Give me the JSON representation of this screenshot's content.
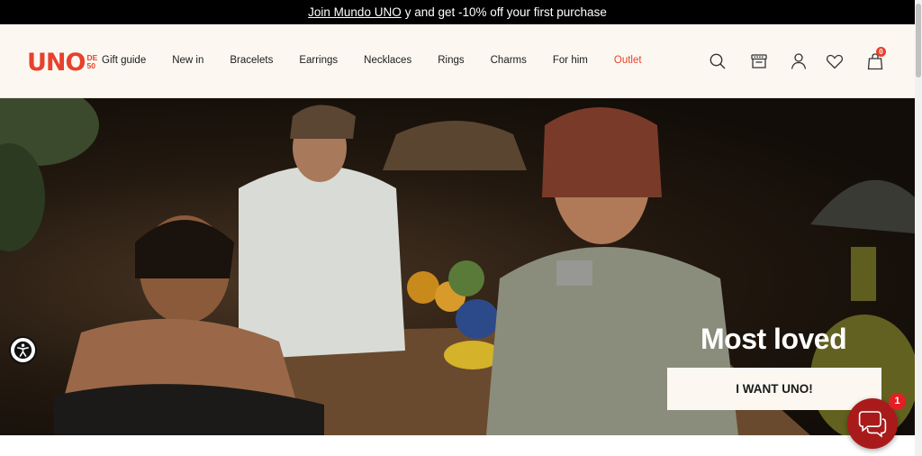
{
  "promo": {
    "link_text": "Join Mundo UNO",
    "rest_text": "y and get -10% off your first purchase"
  },
  "brand": {
    "logo_main": "UNO",
    "logo_sub_top": "DE",
    "logo_sub_bottom": "50",
    "color": "#e8412c"
  },
  "nav": {
    "items": [
      {
        "label": "Gift guide"
      },
      {
        "label": "New in"
      },
      {
        "label": "Bracelets"
      },
      {
        "label": "Earrings"
      },
      {
        "label": "Necklaces"
      },
      {
        "label": "Rings"
      },
      {
        "label": "Charms"
      },
      {
        "label": "For him"
      },
      {
        "label": "Outlet"
      }
    ],
    "outlet_color": "#e8412c"
  },
  "header_icons": [
    {
      "name": "search-icon"
    },
    {
      "name": "store-icon"
    },
    {
      "name": "account-icon"
    },
    {
      "name": "wishlist-heart-icon"
    },
    {
      "name": "cart-bag-icon"
    }
  ],
  "cart": {
    "count": "0"
  },
  "hero": {
    "headline": "Most loved",
    "cta_label": "I WANT UNO!"
  },
  "chat": {
    "badge_count": "1",
    "color": "#a91b1b"
  },
  "accessibility": {
    "icon": "accessibility-icon"
  }
}
